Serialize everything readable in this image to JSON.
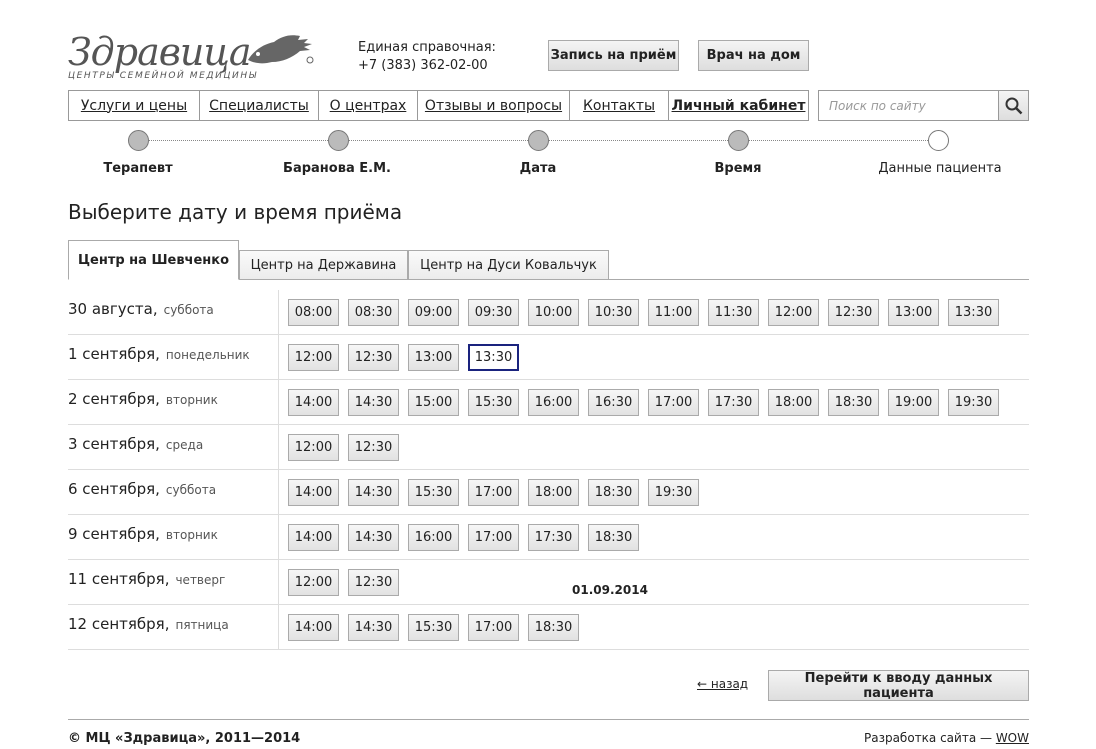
{
  "logo": {
    "name": "Здравица",
    "tagline": "центры семейной медицины"
  },
  "contact": {
    "label": "Единая справочная:",
    "phone": "+7 (383) 362-02-00"
  },
  "header_buttons": {
    "appointment": "Запись на приём",
    "home_visit": "Врач на дом"
  },
  "nav": [
    "Услуги и цены",
    "Специалисты",
    "О центрах",
    "Отзывы и вопросы",
    "Контакты",
    "Личный кабинет"
  ],
  "search": {
    "placeholder": "Поиск по сайту"
  },
  "steps": [
    {
      "label": "Терапевт",
      "done": true
    },
    {
      "label": "Баранова Е.М.",
      "done": true
    },
    {
      "label": "Дата",
      "done": true
    },
    {
      "label": "Время",
      "done": true
    },
    {
      "label": "Данные пациента",
      "done": false
    }
  ],
  "page_title": "Выберите дату и время приёма",
  "tabs": [
    {
      "label": "Центр на Шевченко",
      "active": true
    },
    {
      "label": "Центр на Державина",
      "active": false
    },
    {
      "label": "Центр на Дуси Ковальчук",
      "active": false
    }
  ],
  "schedule": [
    {
      "date": "30 августа,",
      "dow": "суббота",
      "slots": [
        "08:00",
        "08:30",
        "09:00",
        "09:30",
        "10:00",
        "10:30",
        "11:00",
        "11:30",
        "12:00",
        "12:30",
        "13:00",
        "13:30"
      ]
    },
    {
      "date": "1 сентября,",
      "dow": "понедельник",
      "slots": [
        "12:00",
        "12:30",
        "13:00",
        "13:30"
      ],
      "selected": "13:30"
    },
    {
      "date": "2 сентября,",
      "dow": "вторник",
      "slots": [
        "14:00",
        "14:30",
        "15:00",
        "15:30",
        "16:00",
        "16:30",
        "17:00",
        "17:30",
        "18:00",
        "18:30",
        "19:00",
        "19:30"
      ]
    },
    {
      "date": "3 сентября,",
      "dow": "среда",
      "slots": [
        "12:00",
        "12:30"
      ]
    },
    {
      "date": "6 сентября,",
      "dow": "суббота",
      "slots": [
        "14:00",
        "14:30",
        "15:30",
        "17:00",
        "18:00",
        "18:30",
        "19:30"
      ]
    },
    {
      "date": "9 сентября,",
      "dow": "вторник",
      "slots": [
        "14:00",
        "14:30",
        "16:00",
        "17:00",
        "17:30",
        "18:30"
      ]
    },
    {
      "date": "11 сентября,",
      "dow": "четверг",
      "slots": [
        "12:00",
        "12:30"
      ]
    },
    {
      "date": "12 сентября,",
      "dow": "пятница",
      "slots": [
        "14:00",
        "14:30",
        "15:30",
        "17:00",
        "18:30"
      ]
    }
  ],
  "tooltip_date": "01.09.2014",
  "actions": {
    "back": "← назад",
    "next": "Перейти к вводу данных пациента"
  },
  "footer": {
    "copyright": "© МЦ «Здравица», 2011—2014",
    "dev_label": "Разработка сайта —",
    "dev_link": "WOW"
  },
  "colors": {
    "selected_border": "#1a237e",
    "step_done": "#bbbbbb"
  }
}
